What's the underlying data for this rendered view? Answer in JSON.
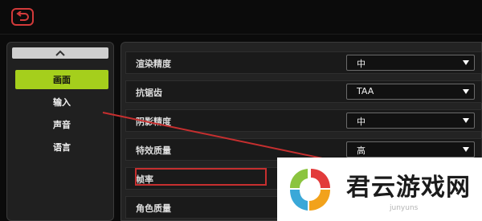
{
  "sidebar": {
    "items": [
      {
        "label": "画面",
        "active": true
      },
      {
        "label": "输入",
        "active": false
      },
      {
        "label": "声音",
        "active": false
      },
      {
        "label": "语言",
        "active": false
      }
    ]
  },
  "settings": {
    "rows": [
      {
        "label": "渲染精度",
        "value": "中"
      },
      {
        "label": "抗锯齿",
        "value": "TAA"
      },
      {
        "label": "阴影精度",
        "value": "中"
      },
      {
        "label": "特效质量",
        "value": "高"
      },
      {
        "label": "帧率",
        "value": ""
      },
      {
        "label": "角色质量",
        "value": ""
      }
    ]
  },
  "watermark": {
    "title": "君云游戏网",
    "subtitle": "junyuns"
  },
  "colors": {
    "accent_green": "#a5cf1c",
    "annotation_red": "#c62f2f"
  },
  "icons": {
    "back": "back-arrow-icon",
    "up": "chevron-up-icon",
    "down": "triangle-down-icon"
  }
}
